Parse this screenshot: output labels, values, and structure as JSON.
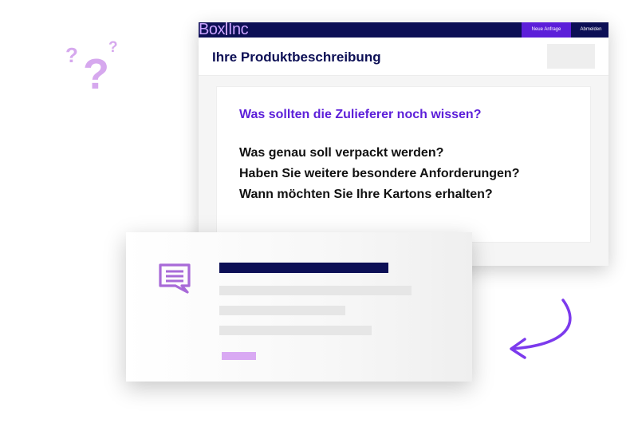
{
  "decor": {
    "question_marks": [
      "?",
      "?",
      "?"
    ]
  },
  "app": {
    "logo": {
      "left": "Box",
      "right": "Inc"
    },
    "nav": {
      "new_request": "Neue Anfrage",
      "logout": "Abmelden"
    },
    "page_title": "Ihre Produktbeschreibung",
    "card": {
      "heading": "Was sollten die Zulieferer noch wissen?",
      "questions": [
        "Was genau soll verpackt werden?",
        "Haben Sie weitere besondere Anforderungen?",
        "Wann möchten Sie Ihre Kartons erhalten?"
      ]
    }
  },
  "floating_card": {
    "icon": "chat-icon"
  },
  "colors": {
    "navy": "#0c0f55",
    "purple": "#5c1fd9",
    "lilac": "#caa3ff",
    "light_purple": "#d9a9f3",
    "arrow": "#7c3aed"
  }
}
